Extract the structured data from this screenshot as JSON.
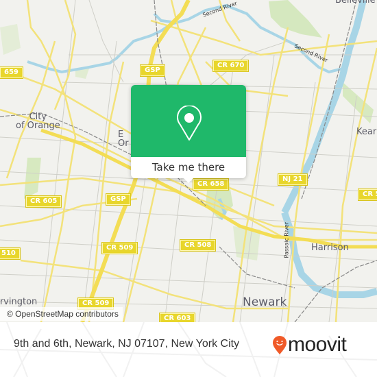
{
  "map": {
    "place_labels": [
      {
        "id": "city-of-orange",
        "text": "City\nof Orange"
      },
      {
        "id": "east-orange",
        "text": "E\nOr"
      },
      {
        "id": "newark",
        "text": "Newark"
      },
      {
        "id": "harrison",
        "text": "Harrison"
      },
      {
        "id": "kearny",
        "text": "Kear"
      },
      {
        "id": "belleville",
        "text": "Belleville"
      },
      {
        "id": "irvington",
        "text": "Irvington"
      }
    ],
    "road_shields": [
      {
        "id": "cr-659",
        "text": "659"
      },
      {
        "id": "gsp-north",
        "text": "GSP"
      },
      {
        "id": "cr-670",
        "text": "CR 670"
      },
      {
        "id": "nj-21",
        "text": "NJ 21"
      },
      {
        "id": "cr-658",
        "text": "CR 658"
      },
      {
        "id": "cr-605",
        "text": "CR 605"
      },
      {
        "id": "gsp-south",
        "text": "GSP"
      },
      {
        "id": "cr-509-a",
        "text": "CR 509"
      },
      {
        "id": "cr-508",
        "text": "CR 508"
      },
      {
        "id": "cr-510",
        "text": "510"
      },
      {
        "id": "cr-509-b",
        "text": "CR 509"
      },
      {
        "id": "cr-603",
        "text": "CR 603"
      },
      {
        "id": "cr-5xx",
        "text": "CR 5"
      }
    ],
    "water_labels": [
      {
        "id": "second-river-1",
        "text": "Second River"
      },
      {
        "id": "second-river-2",
        "text": "Second River"
      },
      {
        "id": "passaic-river",
        "text": "Passaic River"
      }
    ],
    "attribution": "© OpenStreetMap contributors"
  },
  "popup": {
    "icon": "map-pin-icon",
    "button_label": "Take me there",
    "accent_color": "#1fb86a"
  },
  "footer": {
    "address": "9th and 6th, Newark, NJ 07107, New York City",
    "brand_name": "moovit",
    "brand_icon": "moovit-pin-logo-icon",
    "brand_color": "#f05a28"
  }
}
